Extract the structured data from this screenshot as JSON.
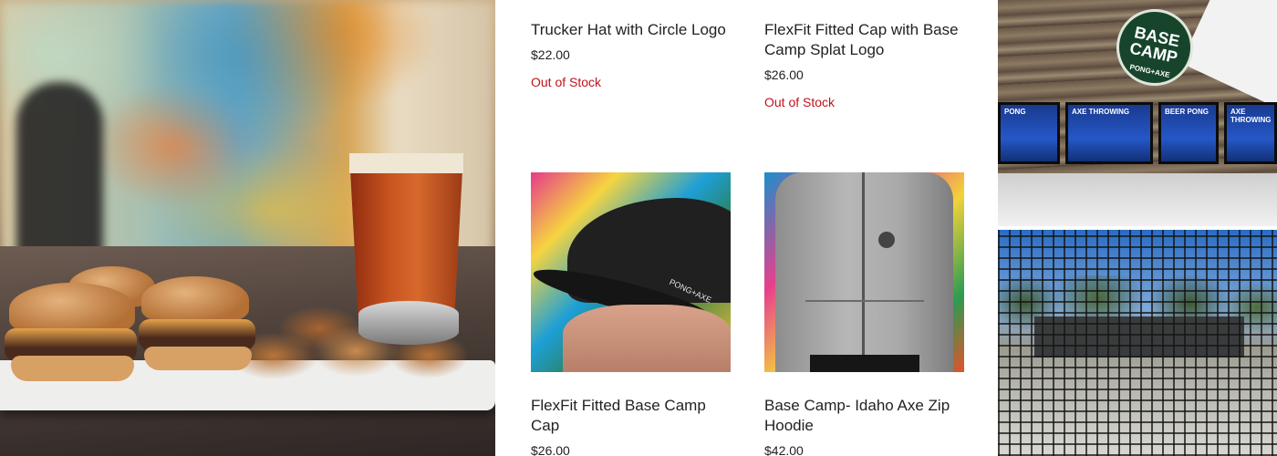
{
  "products": [
    {
      "title": "Trucker Hat with Circle Logo",
      "price": "$22.00",
      "stock": "Out of Stock"
    },
    {
      "title": "FlexFit Fitted Cap with Base Camp Splat Logo",
      "price": "$26.00",
      "stock": "Out of Stock"
    },
    {
      "title": "FlexFit Fitted Base Camp Cap",
      "price": "$26.00"
    },
    {
      "title": "Base Camp- Idaho Axe Zip Hoodie",
      "price": "$42.00"
    }
  ],
  "photo_text": {
    "sign_line1": "BASE",
    "sign_line2": "CAMP",
    "sign_line3": "PONG+AXE",
    "cap_logo": "PONG+AXE",
    "screens": [
      "PONG",
      "AXE THROWING",
      "BEER PONG",
      "AXE THROWING"
    ]
  },
  "colors": {
    "out_of_stock": "#c0121c",
    "text": "#222222"
  }
}
